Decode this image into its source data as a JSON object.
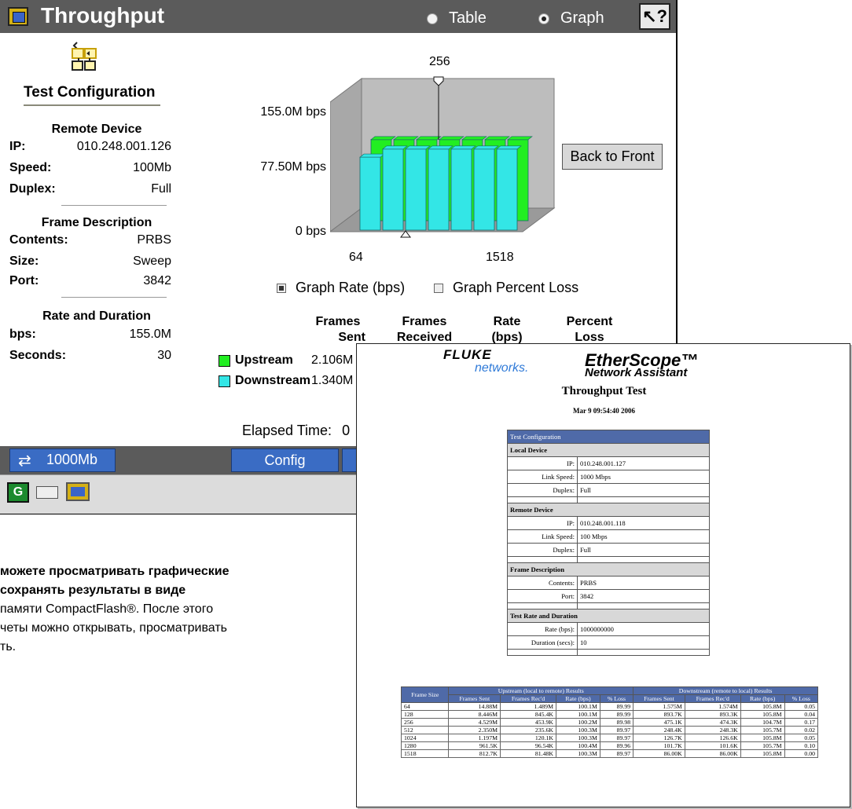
{
  "device": {
    "title": "Throughput",
    "view_options": [
      {
        "label": "Table",
        "selected": false
      },
      {
        "label": "Graph",
        "selected": true
      }
    ],
    "help_icon": "help-pointer-icon",
    "config": {
      "title": "Test Configuration",
      "remote_device": {
        "heading": "Remote Device",
        "rows": [
          {
            "k": "IP:",
            "v": "010.248.001.126"
          },
          {
            "k": "Speed:",
            "v": "100Mb"
          },
          {
            "k": "Duplex:",
            "v": "Full"
          }
        ]
      },
      "frame_description": {
        "heading": "Frame Description",
        "rows": [
          {
            "k": "Contents:",
            "v": "PRBS"
          },
          {
            "k": "Size:",
            "v": "Sweep"
          },
          {
            "k": "Port:",
            "v": "3842"
          }
        ]
      },
      "rate_duration": {
        "heading": "Rate and Duration",
        "rows": [
          {
            "k": "bps:",
            "v": "155.0M"
          },
          {
            "k": "Seconds:",
            "v": "30"
          }
        ]
      }
    },
    "chart": {
      "marker_label": "256",
      "y_labels": [
        "155.0M bps",
        "77.50M bps",
        "0 bps"
      ],
      "x_labels": [
        "64",
        "1518"
      ],
      "back_button": "Back to Front",
      "options": [
        {
          "label": "Graph Rate (bps)",
          "checked": true
        },
        {
          "label": "Graph Percent Loss",
          "checked": false
        }
      ]
    },
    "columns": [
      {
        "line1": "Frames",
        "line2": "Sent"
      },
      {
        "line1": "Frames",
        "line2": "Received"
      },
      {
        "line1": "Rate",
        "line2": "(bps)"
      },
      {
        "line1": "Percent",
        "line2": "Loss"
      }
    ],
    "legend": [
      {
        "label": "Upstream",
        "color": "#22ee22",
        "frames_sent": "2.106M"
      },
      {
        "label": "Downstream",
        "color": "#33e6e6",
        "frames_sent": "1.340M"
      }
    ],
    "elapsed_label": "Elapsed Time:",
    "elapsed_value": "0",
    "bottom": {
      "link_speed": "1000Mb",
      "config_button": "Config"
    }
  },
  "chart_data": {
    "type": "bar",
    "title": "",
    "xlabel": "",
    "ylabel": "",
    "ylim": [
      0,
      155000000
    ],
    "categories": [
      "64",
      "128",
      "256",
      "512",
      "1024",
      "1280",
      "1518"
    ],
    "series": [
      {
        "name": "Upstream",
        "color": "#22ee22",
        "values": [
          100000000,
          100000000,
          100000000,
          100000000,
          100000000,
          100000000,
          100000000
        ]
      },
      {
        "name": "Downstream",
        "color": "#33e6e6",
        "values": [
          90000000,
          100000000,
          100000000,
          100000000,
          100000000,
          100000000,
          100000000
        ]
      }
    ]
  },
  "caption": {
    "bold_line1": "можете просматривать графические",
    "bold_line2": " сохранять результаты в виде",
    "line3": "памяти CompactFlash®. После этого",
    "line4": "четы можно открывать, просматривать",
    "line5": "ть."
  },
  "report": {
    "brand_top": "FLUKE",
    "brand_bottom": "networks.",
    "product": "EtherScope™",
    "product_sub": "Network Assistant",
    "title": "Throughput Test",
    "date": "Mar 9 09:54:40 2006",
    "config_header": "Test Configuration",
    "local_device": {
      "heading": "Local Device",
      "rows": [
        {
          "k": "IP:",
          "v": "010.248.001.127"
        },
        {
          "k": "Link Speed:",
          "v": "1000 Mbps"
        },
        {
          "k": "Duplex:",
          "v": "Full"
        }
      ]
    },
    "remote_device": {
      "heading": "Remote Device",
      "rows": [
        {
          "k": "IP:",
          "v": "010.248.001.118"
        },
        {
          "k": "Link Speed:",
          "v": "100 Mbps"
        },
        {
          "k": "Duplex:",
          "v": "Full"
        }
      ]
    },
    "frame_description": {
      "heading": "Frame Description",
      "rows": [
        {
          "k": "Contents:",
          "v": "PRBS"
        },
        {
          "k": "Port:",
          "v": "3842"
        }
      ]
    },
    "rate_duration": {
      "heading": "Test Rate and Duration",
      "rows": [
        {
          "k": "Rate (bps):",
          "v": "1000000000"
        },
        {
          "k": "Duration (secs):",
          "v": "10"
        }
      ]
    },
    "results": {
      "frame_size_header": "Frame Size",
      "upstream_header": "Upstream (local to remote) Results",
      "downstream_header": "Downstream (remote to local) Results",
      "sub_headers": [
        "Frames Sent",
        "Frames Rec'd",
        "Rate (bps)",
        "% Loss",
        "Frames Sent",
        "Frames Rec'd",
        "Rate (bps)",
        "% Loss"
      ],
      "rows": [
        [
          "64",
          "14.88M",
          "1.489M",
          "100.1M",
          "89.99",
          "1.575M",
          "1.574M",
          "105.8M",
          "0.05"
        ],
        [
          "128",
          "8.446M",
          "845.4K",
          "100.1M",
          "89.99",
          "893.7K",
          "893.3K",
          "105.8M",
          "0.04"
        ],
        [
          "256",
          "4.529M",
          "453.9K",
          "100.2M",
          "89.98",
          "475.1K",
          "474.3K",
          "104.7M",
          "0.17"
        ],
        [
          "512",
          "2.350M",
          "235.6K",
          "100.3M",
          "89.97",
          "248.4K",
          "248.3K",
          "105.7M",
          "0.02"
        ],
        [
          "1024",
          "1.197M",
          "120.1K",
          "100.3M",
          "89.97",
          "126.7K",
          "126.6K",
          "105.8M",
          "0.05"
        ],
        [
          "1280",
          "961.5K",
          "96.54K",
          "100.4M",
          "89.96",
          "101.7K",
          "101.6K",
          "105.7M",
          "0.10"
        ],
        [
          "1518",
          "812.7K",
          "81.48K",
          "100.3M",
          "89.97",
          "86.00K",
          "86.00K",
          "105.8M",
          "0.00"
        ]
      ]
    }
  }
}
